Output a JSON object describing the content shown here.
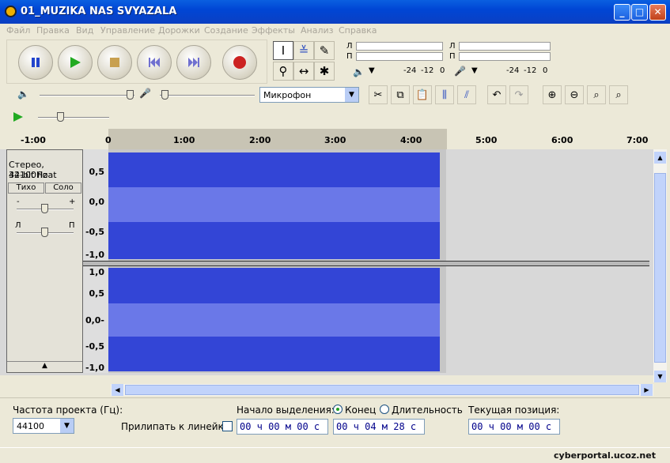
{
  "window": {
    "title": "01_MUZIKA NAS SVYAZALA"
  },
  "menu": [
    "Файл",
    "Правка",
    "Вид",
    "Управление",
    "Дорожки",
    "Создание",
    "Эффекты",
    "Анализ",
    "Справка"
  ],
  "meters": {
    "left_label": "Л",
    "right_label": "П",
    "ticks": [
      "-24",
      "-12",
      "0"
    ]
  },
  "input": {
    "source": "Микрофон"
  },
  "ruler": {
    "ticks": [
      "-1:00",
      "0",
      "1:00",
      "2:00",
      "3:00",
      "4:00",
      "5:00",
      "6:00",
      "7:00"
    ]
  },
  "track": {
    "format": "Стерео, 44100Hz",
    "bitdepth": "32-bit float",
    "mute": "Тихо",
    "solo": "Соло",
    "gain_minus": "-",
    "gain_plus": "+",
    "pan_left": "Л",
    "pan_right": "П"
  },
  "yaxis1": [
    "0,5",
    "0,0",
    "-0,5",
    "-1,0"
  ],
  "yaxis2": [
    "1,0",
    "0,5",
    "0,0-",
    "-0,5",
    "-1,0"
  ],
  "bottom": {
    "rate_label": "Частота проекта (Гц):",
    "rate_value": "44100",
    "snap_label": "Прилипать к линейке",
    "sel_start_label": "Начало выделения:",
    "end_label": "Конец",
    "length_label": "Длительность",
    "sel_start": "00 ч 00 м 00 с",
    "sel_end": "00 ч 04 м 28 с",
    "pos_label": "Текущая позиция:",
    "pos": "00 ч 00 м 00 с"
  },
  "watermark": "cyberportal.ucoz.net"
}
